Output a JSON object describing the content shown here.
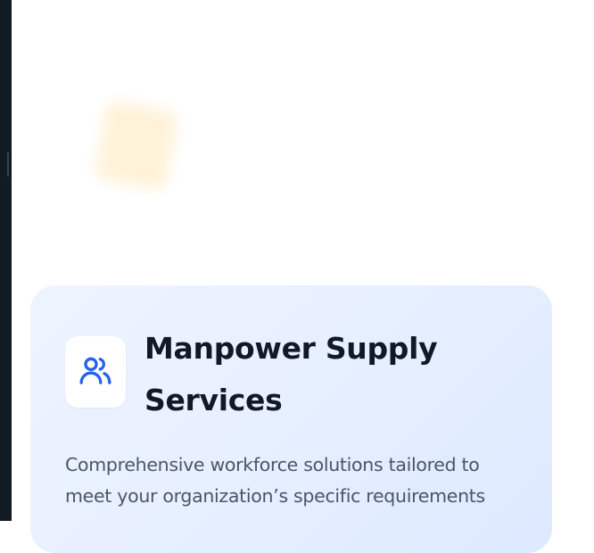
{
  "service_card": {
    "icon": "users-icon",
    "title": "Manpower Supply Services",
    "description": "Comprehensive workforce solutions tailored to meet your organization’s specific requirements"
  },
  "colors": {
    "icon_accent": "#2563eb",
    "title": "#111827",
    "description": "#4a5568",
    "card_background": "#e6efff",
    "decor_square": "#fff2d8",
    "frame_dark": "#121a24"
  }
}
